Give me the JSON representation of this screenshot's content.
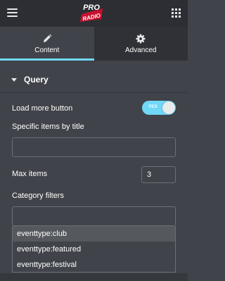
{
  "header": {
    "logo": "PRO RADIO",
    "menu_icon": "hamburger-menu-icon",
    "apps_icon": "grid-apps-icon"
  },
  "tabs": [
    {
      "label": "Content",
      "icon": "pencil-icon",
      "active": true
    },
    {
      "label": "Advanced",
      "icon": "gear-icon",
      "active": false
    }
  ],
  "section": {
    "title": "Query"
  },
  "fields": {
    "load_more": {
      "label": "Load more button",
      "toggle_text": "YES",
      "enabled": true
    },
    "specific_items": {
      "label": "Specific items by title",
      "value": ""
    },
    "max_items": {
      "label": "Max items",
      "value": "3"
    },
    "category_filters": {
      "label": "Category filters",
      "value": "",
      "options": [
        "eventtype:club",
        "eventtype:featured",
        "eventtype:festival"
      ],
      "highlighted": 0
    }
  },
  "colors": {
    "accent": "#71d7f7",
    "panel": "#404349",
    "header": "#2c2e33",
    "inactive_tab": "#2f3136"
  }
}
